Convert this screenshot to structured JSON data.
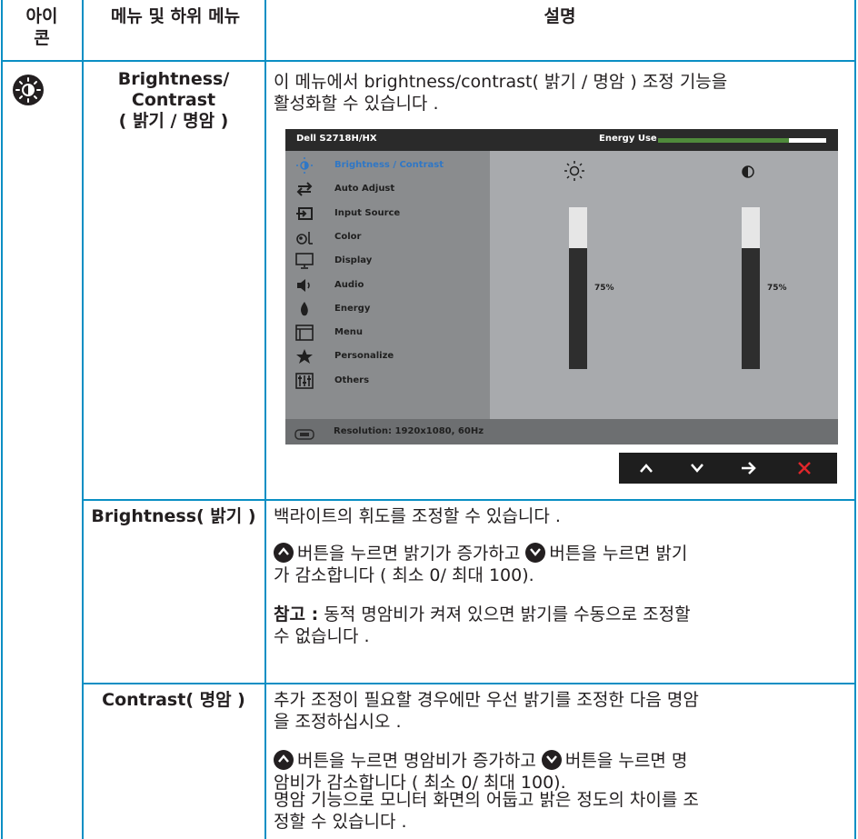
{
  "header": {
    "icon_col": "아이\n콘",
    "menu_col": "메뉴 및 하위 메뉴",
    "desc_col": "설명"
  },
  "rows": {
    "main": {
      "menu": "Brightness/\nContrast\n( 밝기 / 명암 )",
      "desc": "이 메뉴에서 brightness/contrast( 밝기 / 명암 ) 조정 기능을\n활성화할 수 있습니다 ."
    },
    "brightness": {
      "menu": "Brightness( 밝기 )",
      "p1": "백라이트의 휘도를 조정할 수 있습니다 .",
      "p2a": "버튼을 누르면 밝기가 증가하고",
      "p2b": "버튼을 누르면 밝기",
      "p2c": "가 감소합니다 ( 최소 0/ 최대 100).",
      "p3_bold": "참고 :",
      "p3a": " 동적 명암비가 켜져 있으면 밝기를 수동으로 조정할",
      "p3b": "수 없습니다 ."
    },
    "contrast": {
      "menu": "Contrast( 명암 )",
      "p1": "추가 조정이 필요할 경우에만 우선 밝기를 조정한 다음 명암\n을 조정하십시오 .",
      "p2a": "버튼을 누르면 명암비가 증가하고",
      "p2b": "버튼을 누르면 명",
      "p2c": "암비가 감소합니다 ( 최소 0/ 최대 100).",
      "p3": "명암 기능으로 모니터 화면의 어둡고 밝은 정도의 차이를 조\n정할 수 있습니다 ."
    }
  },
  "osd": {
    "model": "Dell S2718H/HX",
    "energy_label": "Energy Use",
    "energy_level": 0.78,
    "menu_items": [
      {
        "label": "Brightness / Contrast",
        "icon": "brightness-icon",
        "active": true
      },
      {
        "label": "Auto Adjust",
        "icon": "auto-adjust-icon",
        "active": false
      },
      {
        "label": "Input Source",
        "icon": "input-source-icon",
        "active": false
      },
      {
        "label": "Color",
        "icon": "color-icon",
        "active": false
      },
      {
        "label": "Display",
        "icon": "display-icon",
        "active": false
      },
      {
        "label": "Audio",
        "icon": "audio-icon",
        "active": false
      },
      {
        "label": "Energy",
        "icon": "energy-icon",
        "active": false
      },
      {
        "label": "Menu",
        "icon": "menu-icon",
        "active": false
      },
      {
        "label": "Personalize",
        "icon": "star-icon",
        "active": false
      },
      {
        "label": "Others",
        "icon": "others-icon",
        "active": false
      }
    ],
    "brightness_value": 75,
    "brightness_pct": "75%",
    "contrast_value": 75,
    "contrast_pct": "75%",
    "resolution": "Resolution: 1920x1080, 60Hz"
  },
  "nav_buttons": [
    "up-arrow-icon",
    "down-arrow-icon",
    "right-arrow-icon",
    "close-icon"
  ],
  "colors": {
    "accent_line": "#0a8fc4",
    "active_item": "#2f77c6",
    "close": "#e0262b",
    "energy": "#4f8a3b"
  }
}
